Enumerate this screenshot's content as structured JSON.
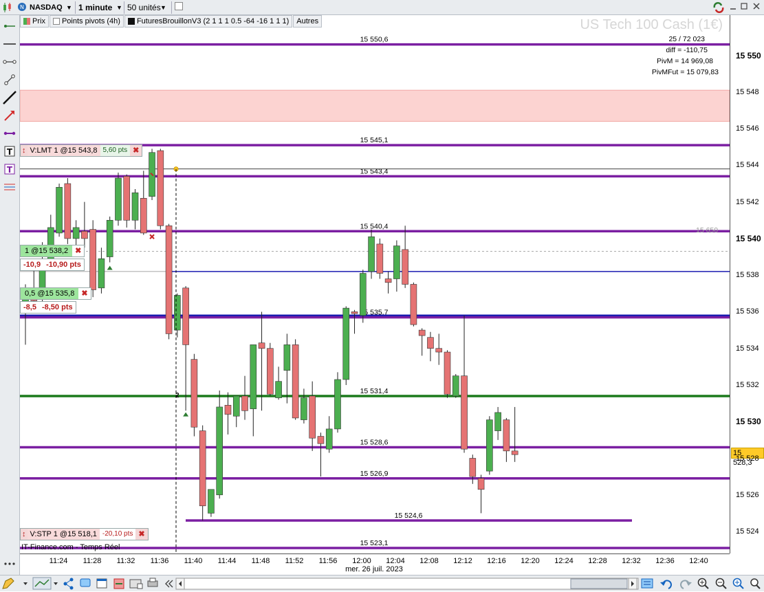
{
  "toolbar": {
    "symbol": "NASDAQ",
    "timeframe": "1 minute",
    "units": "50 unités"
  },
  "legend": {
    "price": "Prix",
    "pivots": "Points pivots (4h)",
    "indicator": "FuturesBrouillonV3 (2 1 1 1 0.5 -64 -16 1 1 1)",
    "others": "Autres"
  },
  "instrument_watermark": "US Tech 100 Cash (1€)",
  "info_panel": {
    "line1": "25 / 72 023",
    "diff": "diff = -110,75",
    "pivm": "PivM = 14 969,08",
    "pivmfut": "PivMFut = 15 079,83"
  },
  "level_labels": [
    "15 550,6",
    "15 545,1",
    "15 543,4",
    "15 540,4",
    "15 535,7",
    "15 531,4",
    "15 528,6",
    "15 526,9",
    "15 524,6",
    "15 523,1"
  ],
  "ghost_level": "15 650",
  "y_axis": {
    "ticks": [
      "15 524",
      "15 526",
      "15 528",
      "15 530",
      "15 532",
      "15 534",
      "15 536",
      "15 538",
      "15 540",
      "15 542",
      "15 544",
      "15 546",
      "15 548",
      "15 550"
    ],
    "current_price": "15 528,3"
  },
  "x_axis": {
    "ticks": [
      "11:24",
      "11:28",
      "11:32",
      "11:36",
      "11:40",
      "11:44",
      "11:48",
      "11:52",
      "11:56",
      "12:00",
      "12:04",
      "12:08",
      "12:12",
      "12:16",
      "12:20",
      "12:24",
      "12:28",
      "12:32",
      "12:36",
      "12:40"
    ],
    "date": "mer. 26 juil. 2023"
  },
  "orders": {
    "limit": {
      "label": "V:LMT  1 @15 543,8",
      "pts": "5,60 pts"
    },
    "pos1": {
      "label": "1 @15 538,2",
      "pl": "-10,9",
      "pts": "-10,90 pts"
    },
    "pos2": {
      "label": "0,5 @15 535,8",
      "pl": "-8,5",
      "pts": "-8,50 pts"
    },
    "stop": {
      "label": "V:STP  1 @15 518,1",
      "pts": "-20,10 pts"
    }
  },
  "marker_label": "2",
  "source": "IT-Finance.com - Temps Réel",
  "colors": {
    "purple": "#7b1fa2",
    "green_line": "#1b7a1b",
    "blue_line": "#1a1ab0",
    "up_candle": "#4caf50",
    "down_candle": "#e57373",
    "zone": "#fcd3d1"
  },
  "chart_data": {
    "type": "candlestick",
    "ylim": [
      15522.8,
      15552.2
    ],
    "candles": [
      {
        "o": 15536.5,
        "h": 15537.5,
        "l": 15534.2,
        "c": 15537.3
      },
      {
        "o": 15537.2,
        "h": 15538.5,
        "l": 15536.0,
        "c": 15536.6
      },
      {
        "o": 15536.8,
        "h": 15539.8,
        "l": 15536.5,
        "c": 15538.5
      },
      {
        "o": 15538.5,
        "h": 15541.3,
        "l": 15538.4,
        "c": 15540.6
      },
      {
        "o": 15540.3,
        "h": 15543.0,
        "l": 15540.1,
        "c": 15542.8
      },
      {
        "o": 15543.0,
        "h": 15543.3,
        "l": 15539.7,
        "c": 15540.0
      },
      {
        "o": 15540.0,
        "h": 15541.0,
        "l": 15539.4,
        "c": 15540.6
      },
      {
        "o": 15540.4,
        "h": 15542.0,
        "l": 15539.5,
        "c": 15540.0
      },
      {
        "o": 15540.5,
        "h": 15541.0,
        "l": 15536.8,
        "c": 15537.2
      },
      {
        "o": 15537.3,
        "h": 15539.5,
        "l": 15537.0,
        "c": 15538.9
      },
      {
        "o": 15539.0,
        "h": 15541.2,
        "l": 15538.7,
        "c": 15541.0
      },
      {
        "o": 15541.0,
        "h": 15543.6,
        "l": 15540.7,
        "c": 15543.3
      },
      {
        "o": 15543.4,
        "h": 15543.5,
        "l": 15540.6,
        "c": 15541.0
      },
      {
        "o": 15541.0,
        "h": 15542.7,
        "l": 15540.5,
        "c": 15542.5
      },
      {
        "o": 15542.2,
        "h": 15543.7,
        "l": 15540.2,
        "c": 15540.3
      },
      {
        "o": 15542.3,
        "h": 15544.9,
        "l": 15542.1,
        "c": 15544.7
      },
      {
        "o": 15544.8,
        "h": 15544.9,
        "l": 15540.5,
        "c": 15540.7
      },
      {
        "o": 15540.7,
        "h": 15540.8,
        "l": 15534.5,
        "c": 15534.8
      },
      {
        "o": 15535.0,
        "h": 15537.0,
        "l": 15534.6,
        "c": 15536.9
      },
      {
        "o": 15537.3,
        "h": 15537.4,
        "l": 15530.6,
        "c": 15534.2
      },
      {
        "o": 15533.4,
        "h": 15533.7,
        "l": 15529.2,
        "c": 15529.7
      },
      {
        "o": 15529.5,
        "h": 15529.8,
        "l": 15524.6,
        "c": 15525.4
      },
      {
        "o": 15525.0,
        "h": 15526.3,
        "l": 15524.8,
        "c": 15526.3
      },
      {
        "o": 15526.0,
        "h": 15531.7,
        "l": 15525.8,
        "c": 15530.8
      },
      {
        "o": 15530.9,
        "h": 15531.6,
        "l": 15529.3,
        "c": 15530.4
      },
      {
        "o": 15530.3,
        "h": 15531.4,
        "l": 15529.7,
        "c": 15531.4
      },
      {
        "o": 15531.4,
        "h": 15532.5,
        "l": 15530.1,
        "c": 15530.6
      },
      {
        "o": 15530.7,
        "h": 15534.2,
        "l": 15529.2,
        "c": 15534.2
      },
      {
        "o": 15534.3,
        "h": 15536.0,
        "l": 15530.6,
        "c": 15534.0
      },
      {
        "o": 15534.0,
        "h": 15534.3,
        "l": 15531.4,
        "c": 15531.5
      },
      {
        "o": 15531.3,
        "h": 15533.0,
        "l": 15531.2,
        "c": 15532.2
      },
      {
        "o": 15532.8,
        "h": 15534.8,
        "l": 15531.0,
        "c": 15534.2
      },
      {
        "o": 15534.2,
        "h": 15534.5,
        "l": 15530.1,
        "c": 15530.2
      },
      {
        "o": 15530.1,
        "h": 15531.8,
        "l": 15529.9,
        "c": 15531.3
      },
      {
        "o": 15531.4,
        "h": 15532.2,
        "l": 15528.4,
        "c": 15529.1
      },
      {
        "o": 15529.2,
        "h": 15529.4,
        "l": 15527.0,
        "c": 15528.8
      },
      {
        "o": 15528.5,
        "h": 15530.3,
        "l": 15528.3,
        "c": 15529.6
      },
      {
        "o": 15529.6,
        "h": 15532.7,
        "l": 15529.4,
        "c": 15532.3
      },
      {
        "o": 15532.3,
        "h": 15536.3,
        "l": 15532.0,
        "c": 15536.2
      },
      {
        "o": 15536.0,
        "h": 15536.1,
        "l": 15534.8,
        "c": 15535.9
      },
      {
        "o": 15535.8,
        "h": 15538.3,
        "l": 15535.4,
        "c": 15538.1
      },
      {
        "o": 15538.2,
        "h": 15540.5,
        "l": 15537.8,
        "c": 15540.1
      },
      {
        "o": 15539.7,
        "h": 15540.0,
        "l": 15537.8,
        "c": 15538.1
      },
      {
        "o": 15537.8,
        "h": 15538.2,
        "l": 15537.0,
        "c": 15537.6
      },
      {
        "o": 15537.8,
        "h": 15539.9,
        "l": 15537.1,
        "c": 15539.6
      },
      {
        "o": 15539.4,
        "h": 15540.7,
        "l": 15537.3,
        "c": 15537.5
      },
      {
        "o": 15537.5,
        "h": 15537.6,
        "l": 15535.2,
        "c": 15535.3
      },
      {
        "o": 15535.0,
        "h": 15535.1,
        "l": 15533.6,
        "c": 15534.7
      },
      {
        "o": 15534.6,
        "h": 15534.9,
        "l": 15533.3,
        "c": 15534.0
      },
      {
        "o": 15534.0,
        "h": 15534.8,
        "l": 15533.1,
        "c": 15533.8
      },
      {
        "o": 15533.8,
        "h": 15533.9,
        "l": 15531.3,
        "c": 15531.5
      },
      {
        "o": 15531.4,
        "h": 15532.6,
        "l": 15531.3,
        "c": 15532.5
      },
      {
        "o": 15532.5,
        "h": 15535.8,
        "l": 15528.3,
        "c": 15528.5
      },
      {
        "o": 15528.0,
        "h": 15528.2,
        "l": 15526.6,
        "c": 15527.0
      },
      {
        "o": 15526.9,
        "h": 15527.1,
        "l": 15525.0,
        "c": 15526.3
      },
      {
        "o": 15527.3,
        "h": 15530.3,
        "l": 15527.1,
        "c": 15530.1
      },
      {
        "o": 15529.5,
        "h": 15530.8,
        "l": 15529.0,
        "c": 15530.5
      },
      {
        "o": 15530.1,
        "h": 15530.2,
        "l": 15527.8,
        "c": 15528.4
      },
      {
        "o": 15528.4,
        "h": 15530.8,
        "l": 15527.8,
        "c": 15528.2
      }
    ]
  }
}
